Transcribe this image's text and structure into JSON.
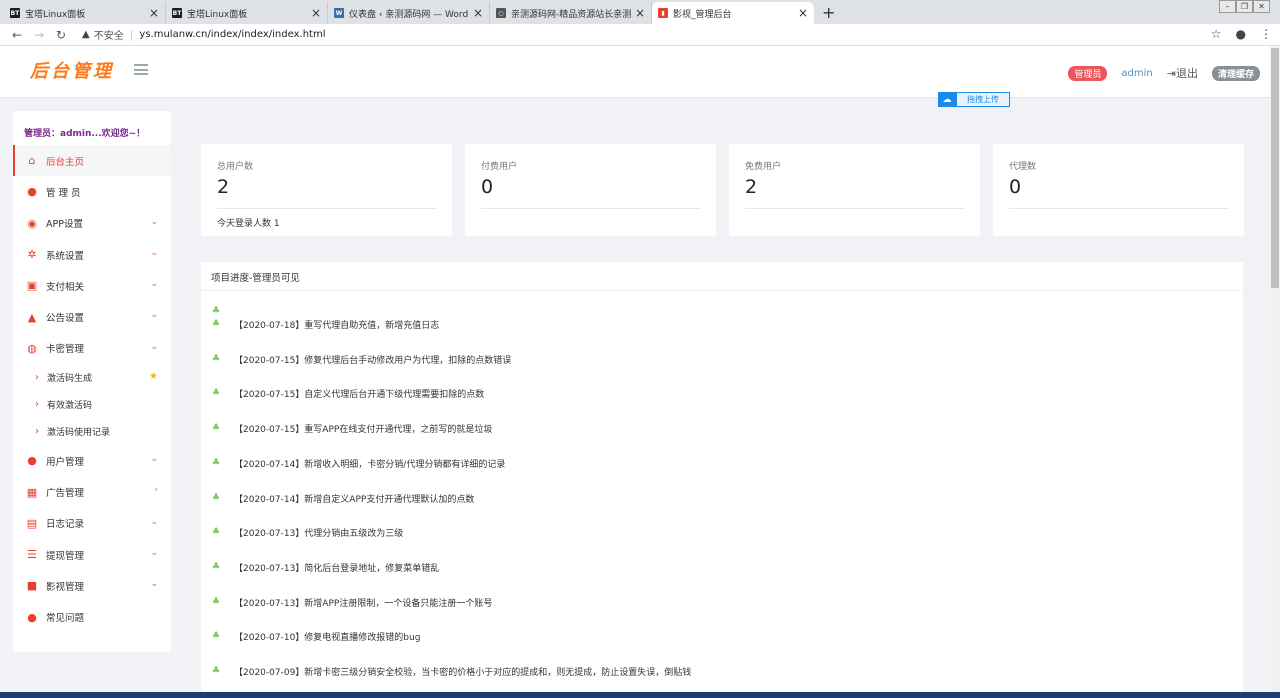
{
  "browser": {
    "tabs": [
      {
        "title": "宝塔Linux面板",
        "favicon": "BT",
        "color": "#1e1e1e"
      },
      {
        "title": "宝塔Linux面板",
        "favicon": "BT",
        "color": "#1e1e1e"
      },
      {
        "title": "仪表盘 ‹ 亲测源码网 — WordPr...",
        "favicon": "W",
        "color": "#3a6ea5"
      },
      {
        "title": "亲测源码网-精品资源站长亲测",
        "favicon": "○",
        "color": "#555"
      },
      {
        "title": "影视_管理后台",
        "favicon": "▮",
        "color": "#e8402f"
      }
    ],
    "new_tab": "+",
    "insecure_label": "不安全",
    "url": "ys.mulanw.cn/index/index/index.html"
  },
  "header": {
    "logo": "后台管理",
    "role_badge": "管理员",
    "username": "admin",
    "logout": "退出",
    "clear_cache": "清理缓存",
    "drag_upload": "拖拽上传"
  },
  "sidebar": {
    "welcome": "管理员：admin...欢迎您~！",
    "items": [
      {
        "label": "后台主页",
        "icon": "home-icon",
        "glyph": "⌂",
        "color": "#e8402f",
        "chevron": ""
      },
      {
        "label": "管 理 员",
        "icon": "user-icon",
        "glyph": "●",
        "color": "#e8402f",
        "chevron": ""
      },
      {
        "label": "APP设置",
        "icon": "soccer-icon",
        "glyph": "◉",
        "color": "#e8402f",
        "chevron": "⌄"
      },
      {
        "label": "系统设置",
        "icon": "gears-icon",
        "glyph": "✲",
        "color": "#e8402f",
        "chevron": "⌄"
      },
      {
        "label": "支付相关",
        "icon": "money-icon",
        "glyph": "▣",
        "color": "#e8402f",
        "chevron": "⌄"
      },
      {
        "label": "公告设置",
        "icon": "bell-icon",
        "glyph": "▲",
        "color": "#e8402f",
        "chevron": "⌄"
      },
      {
        "label": "卡密管理",
        "icon": "globe-icon",
        "glyph": "◍",
        "color": "#e8402f",
        "chevron": "⌄"
      }
    ],
    "subitems": [
      {
        "label": "激活码生成",
        "star": "★"
      },
      {
        "label": "有效激活码",
        "star": ""
      },
      {
        "label": "激活码使用记录",
        "star": ""
      }
    ],
    "items2": [
      {
        "label": "用户管理",
        "icon": "users-icon",
        "glyph": "●",
        "color": "#e8402f",
        "chevron": "⌄"
      },
      {
        "label": "广告管理",
        "icon": "table-icon",
        "glyph": "▦",
        "color": "#e8402f",
        "chevron": "›"
      },
      {
        "label": "日志记录",
        "icon": "printer-icon",
        "glyph": "▤",
        "color": "#e8402f",
        "chevron": "⌄"
      },
      {
        "label": "提现管理",
        "icon": "bars-icon",
        "glyph": "☰",
        "color": "#e8402f",
        "chevron": "⌄"
      },
      {
        "label": "影视管理",
        "icon": "video-icon",
        "glyph": "■",
        "color": "#e8402f",
        "chevron": "⌄"
      },
      {
        "label": "常见问题",
        "icon": "person-icon",
        "glyph": "●",
        "color": "#e8402f",
        "chevron": ""
      }
    ]
  },
  "stats": [
    {
      "label": "总用户数",
      "value": "2",
      "footer": "今天登录人数  1"
    },
    {
      "label": "付费用户",
      "value": "0",
      "footer": ""
    },
    {
      "label": "免费用户",
      "value": "2",
      "footer": ""
    },
    {
      "label": "代理数",
      "value": "0",
      "footer": ""
    }
  ],
  "progress": {
    "title": "项目进度-管理员可见",
    "entries": [
      "【2020-07-18】重写代理自助充值，新增充值日志",
      "【2020-07-15】修复代理后台手动修改用户为代理，扣除的点数错误",
      "【2020-07-15】自定义代理后台开通下级代理需要扣除的点数",
      "【2020-07-15】重写APP在线支付开通代理，之前写的就是垃圾",
      "【2020-07-14】新增收入明细，卡密分销/代理分销都有详细的记录",
      "【2020-07-14】新增自定义APP支付开通代理默认加的点数",
      "【2020-07-13】代理分销由五级改为三级",
      "【2020-07-13】简化后台登录地址，修复菜单错乱",
      "【2020-07-13】新增APP注册限制，一个设备只能注册一个账号",
      "【2020-07-10】修复电视直播修改报错的bug",
      "【2020-07-09】新增卡密三级分销安全校验，当卡密的价格小于对应的提成和，则无提成，防止设置失误，倒贴钱"
    ]
  }
}
